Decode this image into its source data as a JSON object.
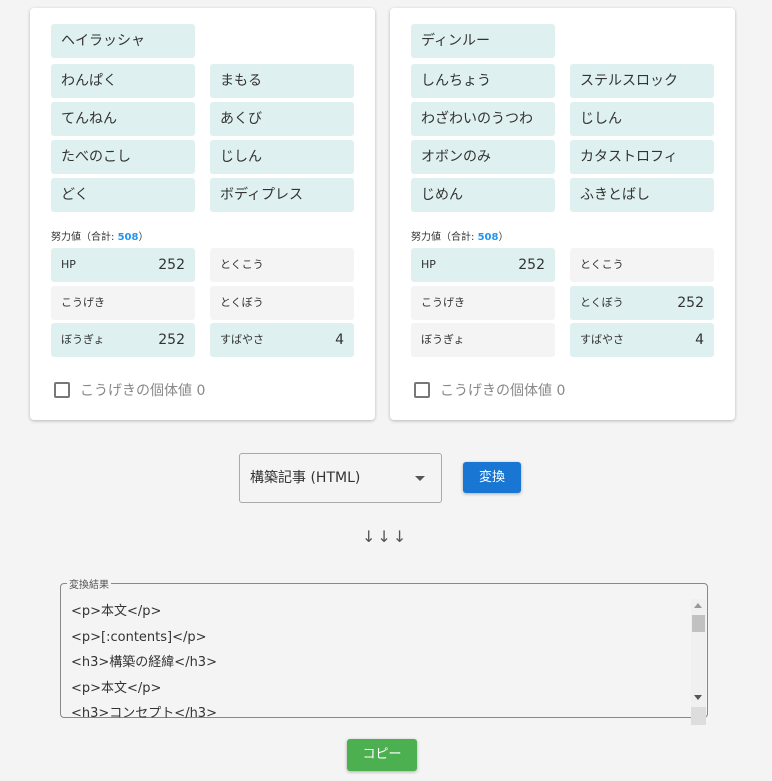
{
  "cards": [
    {
      "pokemon": "ヘイラッシャ",
      "moves": [
        "わんぱく",
        "まもる",
        "てんねん",
        "あくび",
        "たべのこし",
        "じしん",
        "どく",
        "ボディプレス"
      ],
      "ev_label": "努力値（合計: ",
      "ev_total": "508",
      "ev_close": "）",
      "evs": [
        {
          "stat": "HP",
          "value": "252"
        },
        {
          "stat": "とくこう",
          "value": ""
        },
        {
          "stat": "こうげき",
          "value": ""
        },
        {
          "stat": "とくぼう",
          "value": ""
        },
        {
          "stat": "ぼうぎょ",
          "value": "252"
        },
        {
          "stat": "すばやさ",
          "value": "4"
        }
      ],
      "checkbox_label": "こうげきの個体値 0",
      "checked": false
    },
    {
      "pokemon": "ディンルー",
      "moves": [
        "しんちょう",
        "ステルスロック",
        "わざわいのうつわ",
        "じしん",
        "オボンのみ",
        "カタストロフィ",
        "じめん",
        "ふきとばし"
      ],
      "ev_label": "努力値（合計: ",
      "ev_total": "508",
      "ev_close": "）",
      "evs": [
        {
          "stat": "HP",
          "value": "252"
        },
        {
          "stat": "とくこう",
          "value": ""
        },
        {
          "stat": "こうげき",
          "value": ""
        },
        {
          "stat": "とくぼう",
          "value": "252"
        },
        {
          "stat": "ぼうぎょ",
          "value": ""
        },
        {
          "stat": "すばやさ",
          "value": "4"
        }
      ],
      "checkbox_label": "こうげきの個体値 0",
      "checked": false
    }
  ],
  "format_select": "構築記事 (HTML)",
  "convert_button": "変換",
  "arrows": "↓↓↓",
  "result": {
    "legend": "変換結果",
    "lines": [
      "<p>本文</p>",
      "<p>[:contents]</p>",
      "<h3>構築の経緯</h3>",
      "<p>本文</p>",
      "<h3>コンセプト</h3>"
    ]
  },
  "copy_button": "コピー",
  "colors": {
    "primary": "#1976d2",
    "copy": "#4caf50",
    "ev_total": "#2196f3",
    "tile": "#dff0f0"
  }
}
